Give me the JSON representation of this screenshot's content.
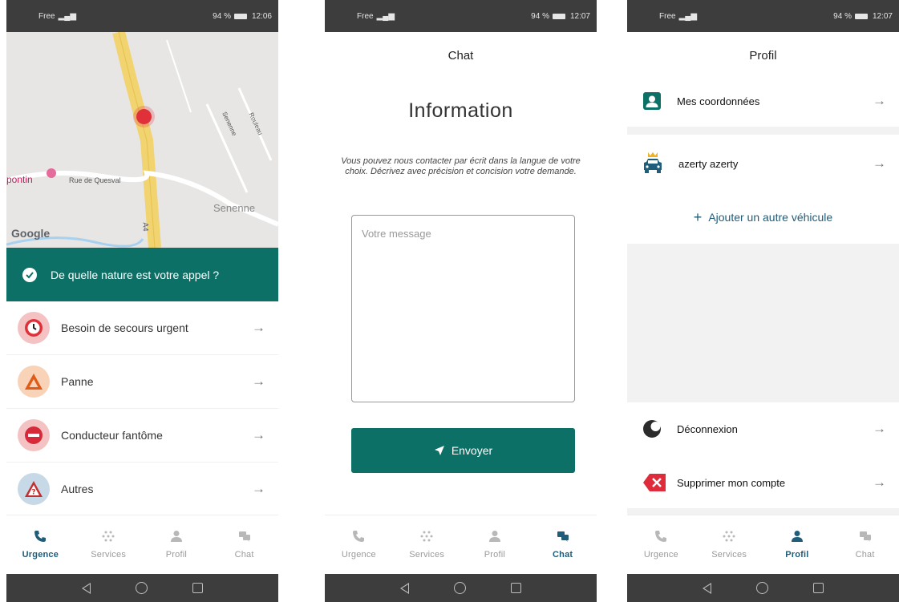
{
  "status": {
    "s1": {
      "left": "Free",
      "right": "94 %",
      "time": "12:06"
    },
    "s2": {
      "left": "Free",
      "right": "94 %",
      "time": "12:07"
    },
    "s3": {
      "left": "Free",
      "right": "94 %",
      "time": "12:07"
    }
  },
  "map": {
    "places": [
      "pontin",
      "Rue de Quesval",
      "Senenne",
      "Senenne",
      "Rouleau",
      "A4"
    ],
    "attribution": "Google"
  },
  "urgence": {
    "question": "De quelle nature est votre appel ?",
    "items": [
      {
        "label": "Besoin de secours urgent",
        "icon": "clock-icon",
        "color": "#e0313a"
      },
      {
        "label": "Panne",
        "icon": "warning-triangle-icon",
        "color": "#e05a18"
      },
      {
        "label": "Conducteur fantôme",
        "icon": "no-entry-icon",
        "color": "#d62a3a"
      },
      {
        "label": "Autres",
        "icon": "question-triangle-icon",
        "color": "#c43030"
      }
    ]
  },
  "chat": {
    "title": "Chat",
    "heading": "Information",
    "text": "Vous pouvez nous contacter par écrit dans la langue de votre choix. Décrivez avec précision et concision votre demande.",
    "placeholder": "Votre message",
    "send": "Envoyer"
  },
  "profil": {
    "title": "Profil",
    "coords": "Mes coordonnées",
    "vehicle": "azerty azerty",
    "add_vehicle": "Ajouter un autre véhicule",
    "logout": "Déconnexion",
    "delete": "Supprimer mon compte"
  },
  "tabs": {
    "urgence": "Urgence",
    "services": "Services",
    "profil": "Profil",
    "chat": "Chat"
  },
  "colors": {
    "primary": "#0d7066",
    "tab_active": "#1f5d7a"
  }
}
